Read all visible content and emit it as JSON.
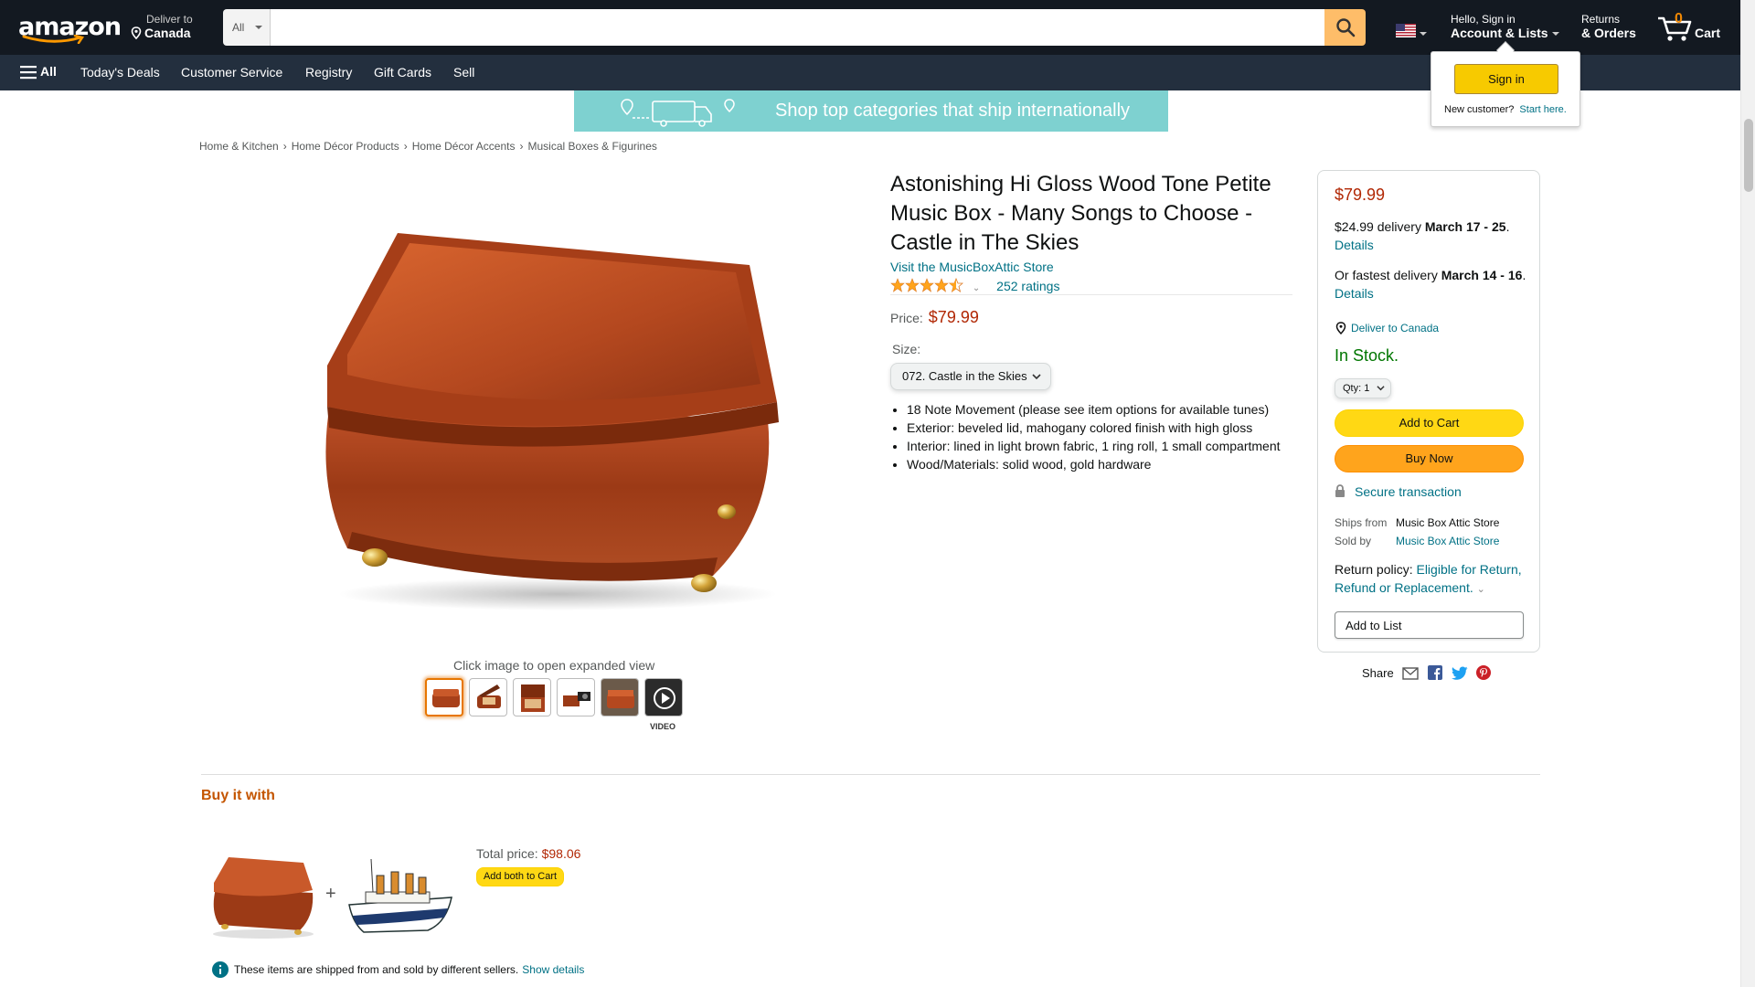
{
  "nav": {
    "logo": "amazon",
    "deliver_line1": "Deliver to",
    "deliver_line2": "Canada",
    "search_category": "All",
    "search_placeholder": "",
    "account_line1": "Hello, Sign in",
    "account_line2": "Account & Lists",
    "returns_line1": "Returns",
    "returns_line2": "& Orders",
    "cart_count": "0",
    "cart_label": "Cart"
  },
  "subnav": {
    "all": "All",
    "items": [
      "Today's Deals",
      "Customer Service",
      "Registry",
      "Gift Cards",
      "Sell"
    ]
  },
  "flyout": {
    "signin": "Sign in",
    "new_customer": "New customer?",
    "start_here": "Start here."
  },
  "banner": {
    "text": "Shop top categories that ship internationally"
  },
  "breadcrumb": [
    "Home & Kitchen",
    "Home Décor Products",
    "Home Décor Accents",
    "Musical Boxes & Figurines"
  ],
  "gallery": {
    "caption": "Click image to open expanded view",
    "video_label": "VIDEO"
  },
  "product": {
    "title": "Astonishing Hi Gloss Wood Tone Petite Music Box - Many Songs to Choose - Castle in The Skies",
    "store_link": "Visit the MusicBoxAttic Store",
    "rating_stars": 4.5,
    "ratings_count": "252 ratings",
    "price_label": "Price:",
    "price": "$79.99",
    "size_label": "Size:",
    "size_selected": "072. Castle in the Skies",
    "bullets": [
      "18 Note Movement (please see item options for available tunes)",
      "Exterior: beveled lid, mahogany colored finish with high gloss",
      "Interior: lined in light brown fabric, 1 ring roll, 1 small compartment",
      "Wood/Materials: solid wood, gold hardware"
    ]
  },
  "buybox": {
    "price": "$79.99",
    "delivery_text": "$24.99 delivery",
    "delivery_dates": "March 17 - 25",
    "details": "Details",
    "fast_text": "Or fastest delivery",
    "fast_dates": "March 14 - 16",
    "deliver_to": "Deliver to Canada",
    "stock": "In Stock.",
    "qty_label": "Qty:",
    "qty_value": "1",
    "add_to_cart": "Add to Cart",
    "buy_now": "Buy Now",
    "secure": "Secure transaction",
    "ships_from_label": "Ships from",
    "ships_from": "Music Box Attic Store",
    "sold_by_label": "Sold by",
    "sold_by": "Music Box Attic Store",
    "return_label": "Return policy:",
    "return_link": "Eligible for Return, Refund or Replacement.",
    "add_to_list": "Add to List"
  },
  "share": {
    "label": "Share"
  },
  "buy_it_with": {
    "title": "Buy it with",
    "total_label": "Total price:",
    "total": "$98.06",
    "add_both": "Add both to Cart",
    "note": "These items are shipped from and sold by different sellers.",
    "show_details": "Show details"
  },
  "colors": {
    "nav_bg": "#131921",
    "subnav_bg": "#232f3e",
    "price": "#B12704",
    "link": "#007185",
    "stock": "#007600",
    "cart_btn": "#FFD814",
    "buy_btn": "#FFA41C"
  }
}
